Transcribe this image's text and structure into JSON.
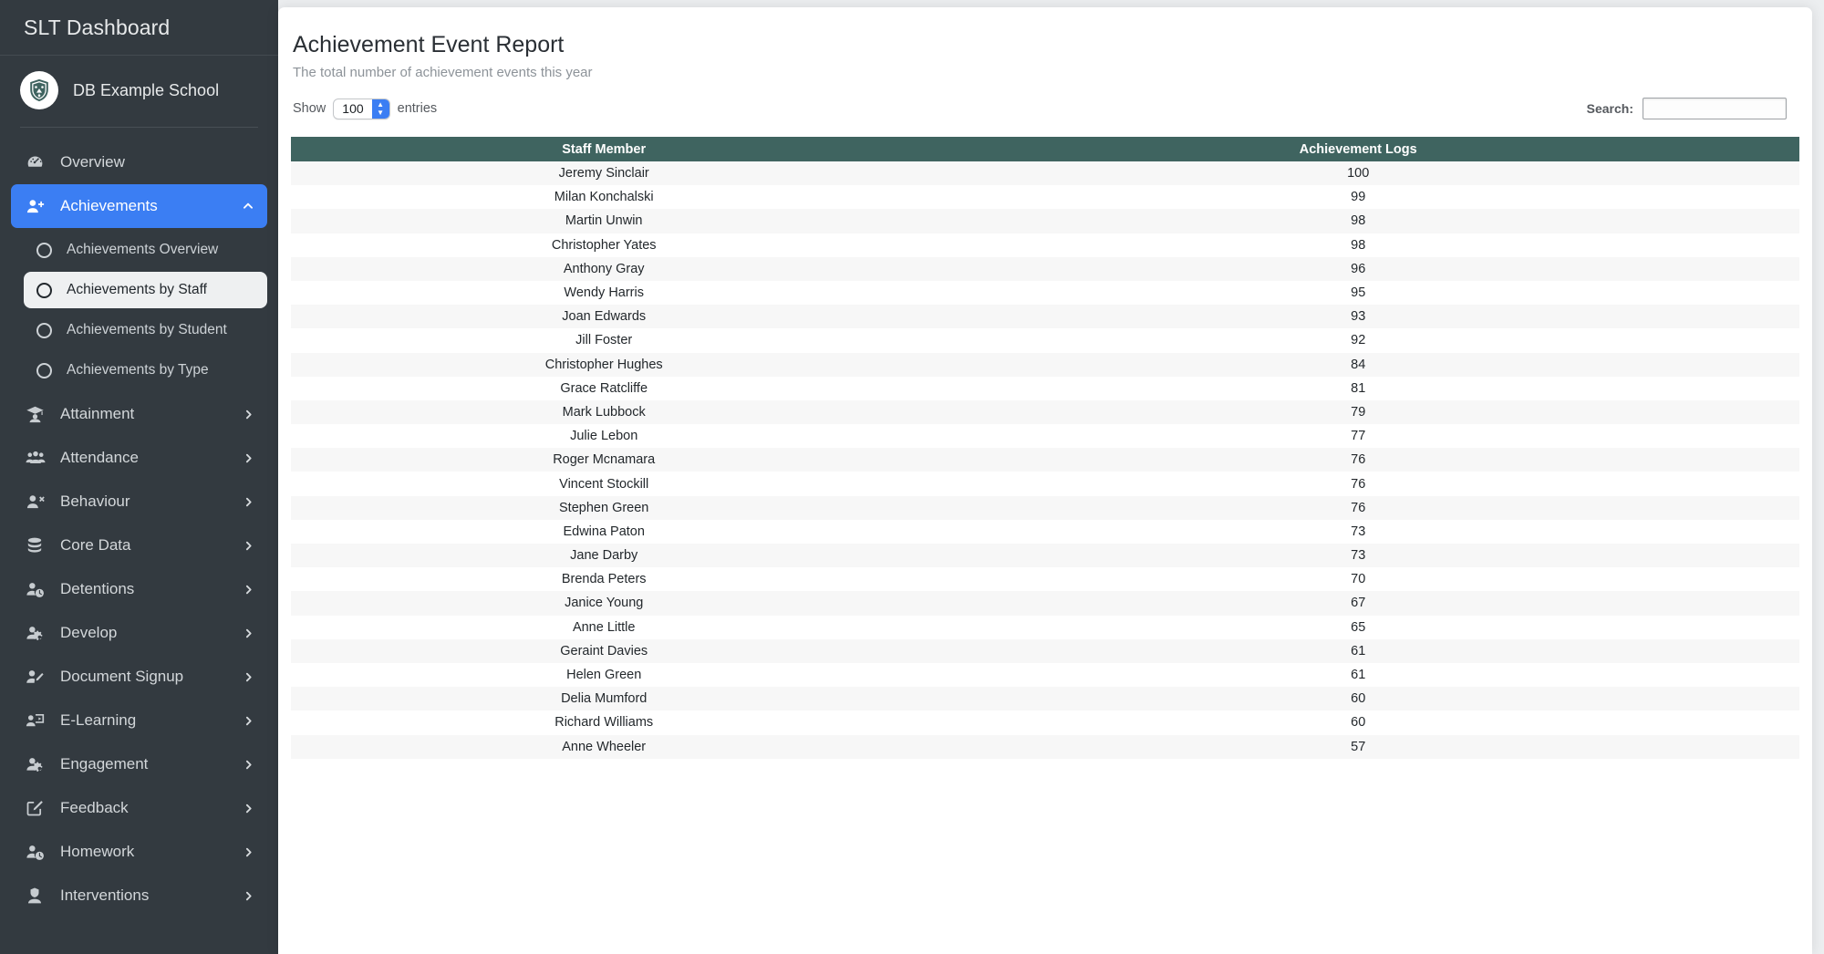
{
  "sidebar": {
    "title": "SLT Dashboard",
    "school": {
      "name": "DB Example School",
      "logo_icon": "school-crest-icon"
    },
    "items": [
      {
        "label": "Overview",
        "icon": "dashboard-gauge-icon",
        "chevron": "",
        "active": false
      },
      {
        "label": "Achievements",
        "icon": "user-plus-icon",
        "chevron": "chevron-up-icon",
        "active": true
      },
      {
        "label": "Attainment",
        "icon": "graduation-cap-icon",
        "chevron": "chevron-right-icon",
        "active": false
      },
      {
        "label": "Attendance",
        "icon": "users-group-icon",
        "chevron": "chevron-right-icon",
        "active": false
      },
      {
        "label": "Behaviour",
        "icon": "user-times-icon",
        "chevron": "chevron-right-icon",
        "active": false
      },
      {
        "label": "Core Data",
        "icon": "database-icon",
        "chevron": "chevron-right-icon",
        "active": false
      },
      {
        "label": "Detentions",
        "icon": "user-clock-icon",
        "chevron": "chevron-right-icon",
        "active": false
      },
      {
        "label": "Develop",
        "icon": "user-gear-icon",
        "chevron": "chevron-right-icon",
        "active": false
      },
      {
        "label": "Document Signup",
        "icon": "user-edit-icon",
        "chevron": "chevron-right-icon",
        "active": false
      },
      {
        "label": "E-Learning",
        "icon": "user-screen-icon",
        "chevron": "chevron-right-icon",
        "active": false
      },
      {
        "label": "Engagement",
        "icon": "user-gear-icon",
        "chevron": "chevron-right-icon",
        "active": false
      },
      {
        "label": "Feedback",
        "icon": "pencil-square-icon",
        "chevron": "chevron-right-icon",
        "active": false
      },
      {
        "label": "Homework",
        "icon": "user-clock-icon",
        "chevron": "chevron-right-icon",
        "active": false
      },
      {
        "label": "Interventions",
        "icon": "user-shield-icon",
        "chevron": "chevron-right-icon",
        "active": false
      }
    ],
    "subitems": [
      {
        "label": "Achievements Overview",
        "selected": false
      },
      {
        "label": "Achievements by Staff",
        "selected": true
      },
      {
        "label": "Achievements by Student",
        "selected": false
      },
      {
        "label": "Achievements by Type",
        "selected": false
      }
    ]
  },
  "report": {
    "title": "Achievement Event Report",
    "subtitle": "The total number of achievement events this year",
    "show_label": "Show",
    "entries_label": "entries",
    "entries_value": "100",
    "search_label": "Search:",
    "search_value": "",
    "search_placeholder": ""
  },
  "colors": {
    "sidebar_bg": "#333a40",
    "accent_blue": "#3b7ef3",
    "table_header": "#3f6460"
  },
  "chart_data": {
    "type": "table",
    "title": "Achievement Event Report",
    "columns": [
      "Staff Member",
      "Achievement Logs"
    ],
    "rows": [
      [
        "Jeremy Sinclair",
        100
      ],
      [
        "Milan Konchalski",
        99
      ],
      [
        "Martin Unwin",
        98
      ],
      [
        "Christopher Yates",
        98
      ],
      [
        "Anthony Gray",
        96
      ],
      [
        "Wendy Harris",
        95
      ],
      [
        "Joan Edwards",
        93
      ],
      [
        "Jill Foster",
        92
      ],
      [
        "Christopher Hughes",
        84
      ],
      [
        "Grace Ratcliffe",
        81
      ],
      [
        "Mark Lubbock",
        79
      ],
      [
        "Julie Lebon",
        77
      ],
      [
        "Roger Mcnamara",
        76
      ],
      [
        "Vincent Stockill",
        76
      ],
      [
        "Stephen Green",
        76
      ],
      [
        "Edwina Paton",
        73
      ],
      [
        "Jane Darby",
        73
      ],
      [
        "Brenda Peters",
        70
      ],
      [
        "Janice Young",
        67
      ],
      [
        "Anne Little",
        65
      ],
      [
        "Geraint Davies",
        61
      ],
      [
        "Helen Green",
        61
      ],
      [
        "Delia Mumford",
        60
      ],
      [
        "Richard Williams",
        60
      ],
      [
        "Anne Wheeler",
        57
      ]
    ]
  }
}
